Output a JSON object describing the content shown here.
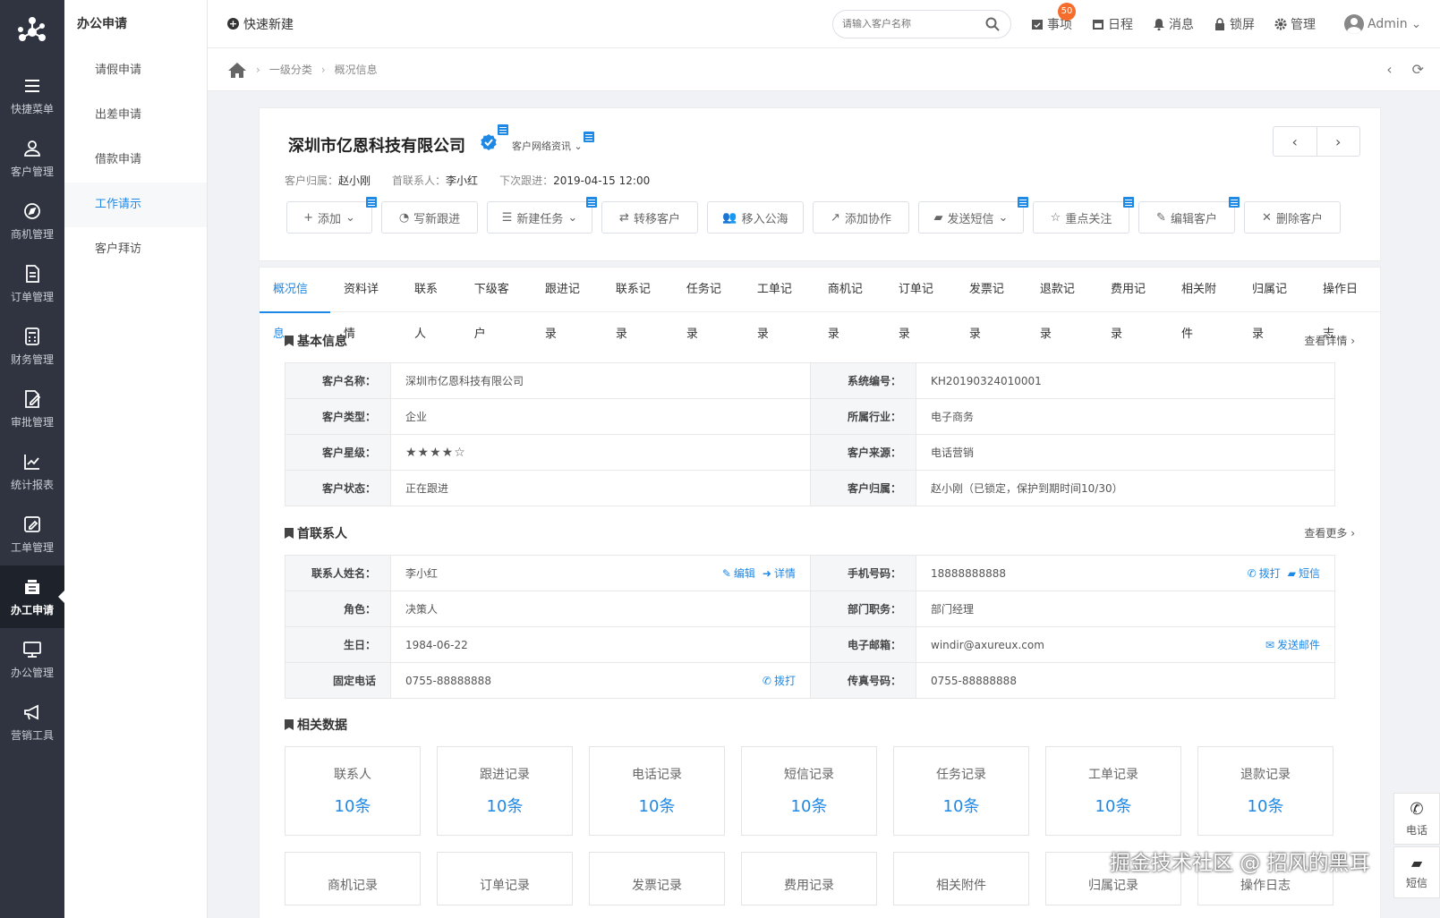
{
  "rail": {
    "items": [
      {
        "label": "快捷菜单",
        "icon": "menu-icon"
      },
      {
        "label": "客户管理",
        "icon": "customer-icon"
      },
      {
        "label": "商机管理",
        "icon": "compass-icon"
      },
      {
        "label": "订单管理",
        "icon": "document-icon"
      },
      {
        "label": "财务管理",
        "icon": "calculator-icon"
      },
      {
        "label": "审批管理",
        "icon": "approval-icon"
      },
      {
        "label": "统计报表",
        "icon": "chart-icon"
      },
      {
        "label": "工单管理",
        "icon": "edit-icon"
      },
      {
        "label": "办工申请",
        "icon": "inbox-icon"
      },
      {
        "label": "办公管理",
        "icon": "monitor-icon"
      },
      {
        "label": "营销工具",
        "icon": "megaphone-icon"
      }
    ]
  },
  "submenu": {
    "title": "办公申请",
    "items": [
      "请假申请",
      "出差申请",
      "借款申请",
      "工作请示",
      "客户拜访"
    ]
  },
  "topbar": {
    "quick_new": "快速新建",
    "search_placeholder": "请输入客户名称",
    "tools": {
      "todo": "事项",
      "todo_badge": "50",
      "schedule": "日程",
      "message": "消息",
      "lock": "锁屏",
      "manage": "管理"
    },
    "user": "Admin"
  },
  "breadcrumb": {
    "level1": "一级分类",
    "level2": "概况信息"
  },
  "header": {
    "company": "深圳市亿恩科技有限公司",
    "net_info": "客户网络资讯",
    "owner_label": "客户归属：",
    "owner": "赵小刚",
    "contact_label": "首联系人：",
    "contact": "李小红",
    "next_label": "下次跟进：",
    "next": "2019-04-15 12:00",
    "actions": [
      "添加",
      "写新跟进",
      "新建任务",
      "转移客户",
      "移入公海",
      "添加协作",
      "发送短信",
      "重点关注",
      "编辑客户",
      "删除客户"
    ]
  },
  "tabs": [
    "概况信息",
    "资料详情",
    "联系人",
    "下级客户",
    "跟进记录",
    "联系记录",
    "任务记录",
    "工单记录",
    "商机记录",
    "订单记录",
    "发票记录",
    "退款记录",
    "费用记录",
    "相关附件",
    "归属记录",
    "操作日志"
  ],
  "basic": {
    "title": "基本信息",
    "more": "查看详情",
    "rows": [
      {
        "k1": "客户名称：",
        "v1": "深圳市亿恩科技有限公司",
        "k2": "系统编号：",
        "v2": "KH20190324010001"
      },
      {
        "k1": "客户类型：",
        "v1": "企业",
        "k2": "所属行业：",
        "v2": "电子商务"
      },
      {
        "k1": "客户星级：",
        "v1": "★★★★☆",
        "k2": "客户来源：",
        "v2": "电话营销"
      },
      {
        "k1": "客户状态：",
        "v1": "正在跟进",
        "k2": "客户归属：",
        "v2": "赵小刚（已锁定，保护到期时间10/30）"
      }
    ],
    "rating": 4
  },
  "contact": {
    "title": "首联系人",
    "more": "查看更多",
    "rows": [
      {
        "k1": "联系人姓名：",
        "v1": "李小红",
        "k2": "手机号码：",
        "v2": "18888888888"
      },
      {
        "k1": "角色：",
        "v1": "决策人",
        "k2": "部门职务：",
        "v2": "部门经理"
      },
      {
        "k1": "生日：",
        "v1": "1984-06-22",
        "k2": "电子邮箱：",
        "v2": "windir@axureux.com"
      },
      {
        "k1": "固定电话",
        "v1": "0755-88888888",
        "k2": "传真号码：",
        "v2": "0755-88888888"
      }
    ],
    "links": {
      "edit": "编辑",
      "detail": "详情",
      "call": "拨打",
      "sms": "短信",
      "email": "发送邮件"
    }
  },
  "related": {
    "title": "相关数据",
    "stats": [
      {
        "label": "联系人",
        "count": "10条"
      },
      {
        "label": "跟进记录",
        "count": "10条"
      },
      {
        "label": "电话记录",
        "count": "10条"
      },
      {
        "label": "短信记录",
        "count": "10条"
      },
      {
        "label": "任务记录",
        "count": "10条"
      },
      {
        "label": "工单记录",
        "count": "10条"
      },
      {
        "label": "退款记录",
        "count": "10条"
      },
      {
        "label": "商机记录"
      },
      {
        "label": "订单记录"
      },
      {
        "label": "发票记录"
      },
      {
        "label": "费用记录"
      },
      {
        "label": "相关附件"
      },
      {
        "label": "归属记录"
      },
      {
        "label": "操作日志"
      }
    ]
  },
  "float": {
    "phone": "电话",
    "sms": "短信"
  },
  "watermark": "掘金技术社区 @ 招风的黑耳",
  "colors": {
    "accent": "#1e88e5",
    "rail_bg": "#2f3440",
    "badge": "#f56c2b"
  }
}
